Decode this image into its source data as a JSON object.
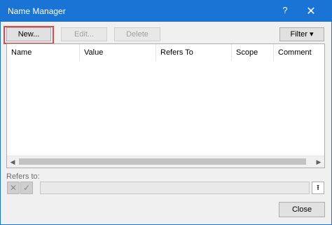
{
  "window": {
    "title": "Name Manager",
    "help": "?",
    "close": "✕"
  },
  "toolbar": {
    "new_label": "New...",
    "edit_label": "Edit...",
    "delete_label": "Delete",
    "filter_label": "Filter ▾"
  },
  "table": {
    "columns": [
      "Name",
      "Value",
      "Refers To",
      "Scope",
      "Comment"
    ]
  },
  "scrollbar": {
    "left": "◀",
    "right": "▶"
  },
  "refers": {
    "label": "Refers to:",
    "cancel_icon": "✕",
    "confirm_icon": "✓",
    "collapse_icon": "⭱",
    "value": ""
  },
  "footer": {
    "close_label": "Close"
  }
}
